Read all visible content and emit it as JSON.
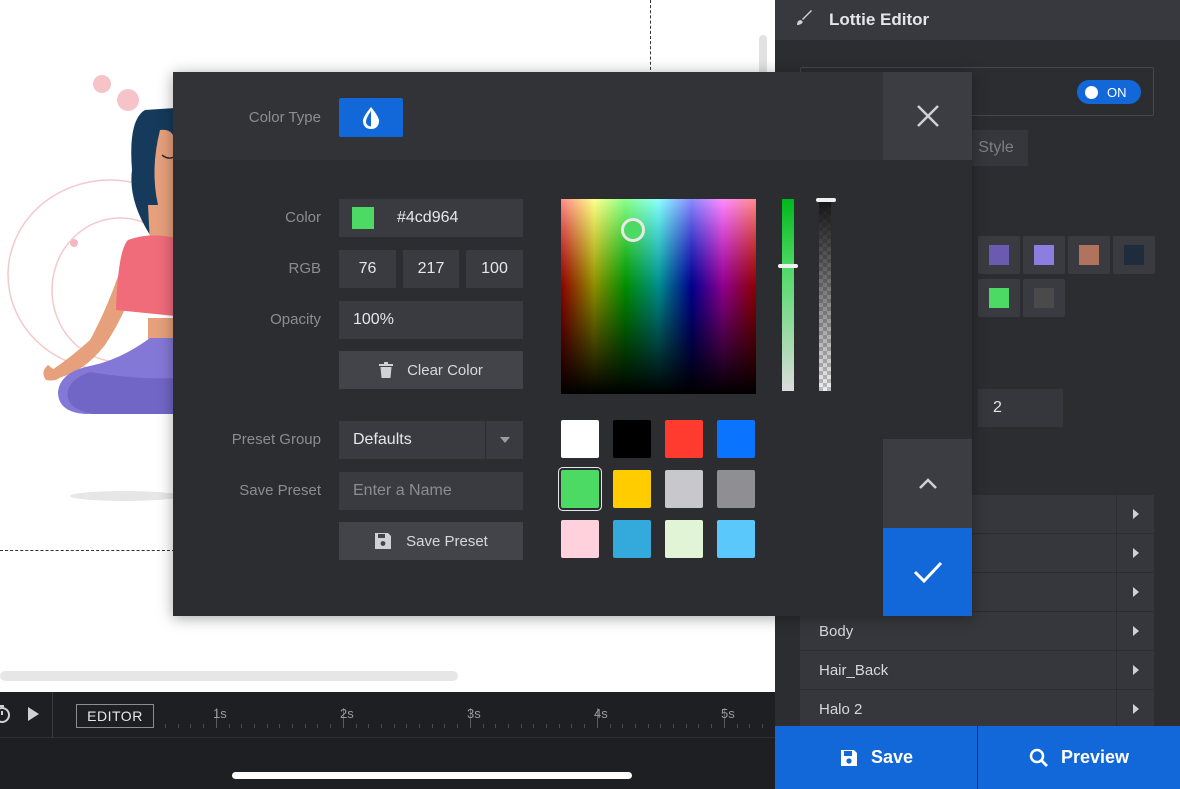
{
  "sidebar": {
    "title": "Lottie Editor",
    "toggle_label": "ON",
    "style_tab": "Style",
    "number_value": "2",
    "swatches": [
      "#6a5ab0",
      "#8b7ee0",
      "#b0735e",
      "#1f2c3e",
      "#4cd964",
      "#4a4a4a"
    ],
    "layers": [
      "Body",
      "Hair_Back",
      "Halo 2"
    ],
    "save_label": "Save",
    "preview_label": "Preview"
  },
  "timeline": {
    "editor_label": "EDITOR",
    "ticks": [
      "1s",
      "2s",
      "3s",
      "4s",
      "5s"
    ]
  },
  "picker": {
    "color_type_label": "Color Type",
    "color_label": "Color",
    "hex_value": "#4cd964",
    "rgb_label": "RGB",
    "r": "76",
    "g": "217",
    "b": "100",
    "opacity_label": "Opacity",
    "opacity_value": "100%",
    "clear_label": "Clear Color",
    "preset_group_label": "Preset Group",
    "preset_group_value": "Defaults",
    "save_preset_label": "Save Preset",
    "name_placeholder": "Enter a Name",
    "save_preset_button": "Save Preset",
    "presets": [
      "#ffffff",
      "#000000",
      "#ff3b30",
      "#0a74ff",
      "#4cd964",
      "#ffcc00",
      "#c7c7cc",
      "#8e8e93",
      "#ffd1dc",
      "#34aadc",
      "#e1f5d6",
      "#5ac8fa"
    ],
    "selected_index": 4,
    "accent": "#1267d9"
  }
}
